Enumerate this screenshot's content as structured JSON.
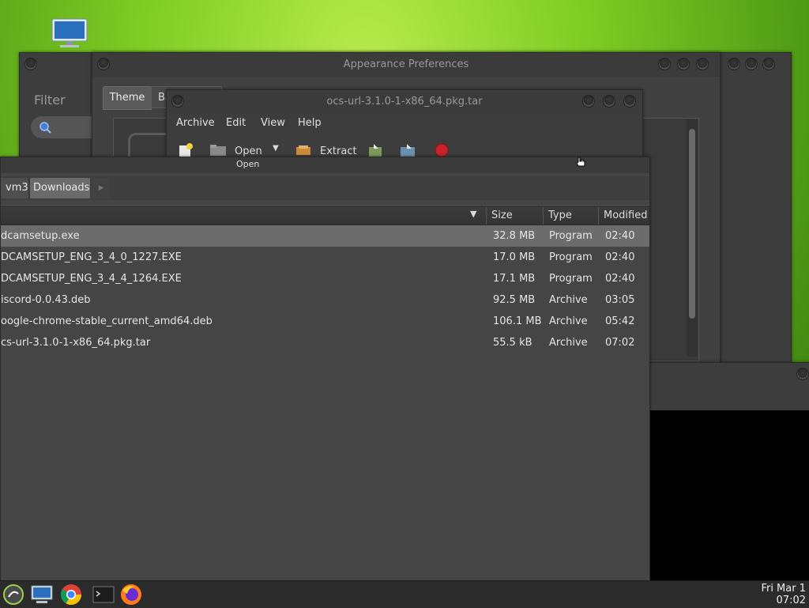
{
  "desktop": {
    "icon": "computer-icon"
  },
  "filter_window": {
    "filter_label": "Filter",
    "search_icon": "search-icon"
  },
  "appearance_window": {
    "title": "Appearance Preferences",
    "tabs": [
      "Theme",
      "Ba"
    ]
  },
  "archive_window": {
    "title": "ocs-url-3.1.0-1-x86_64.pkg.tar",
    "menu": [
      "Archive",
      "Edit",
      "View",
      "Help"
    ],
    "toolbar": {
      "open_label": "Open",
      "extract_label": "Extract"
    }
  },
  "file_chooser": {
    "title": "Open",
    "breadcrumbs": [
      "vm3",
      "Downloads"
    ],
    "columns": {
      "size": "Size",
      "type": "Type",
      "modified": "Modified"
    },
    "files": [
      {
        "name": "dcamsetup.exe",
        "size": "32.8 MB",
        "type": "Program",
        "modified": "02:40",
        "selected": true
      },
      {
        "name": "DCAMSETUP_ENG_3_4_0_1227.EXE",
        "size": "17.0 MB",
        "type": "Program",
        "modified": "02:40"
      },
      {
        "name": "DCAMSETUP_ENG_3_4_4_1264.EXE",
        "size": "17.1 MB",
        "type": "Program",
        "modified": "02:40"
      },
      {
        "name": "iscord-0.0.43.deb",
        "size": "92.5 MB",
        "type": "Archive",
        "modified": "03:05"
      },
      {
        "name": "oogle-chrome-stable_current_amd64.deb",
        "size": "106.1 MB",
        "type": "Archive",
        "modified": "05:42"
      },
      {
        "name": "cs-url-3.1.0-1-x86_64.pkg.tar",
        "size": "55.5 kB",
        "type": "Archive",
        "modified": "07:02"
      }
    ]
  },
  "taskbar": {
    "icons": [
      "menu-icon",
      "computer-icon",
      "chrome-icon",
      "terminal-icon",
      "firefox-icon"
    ],
    "clock": {
      "date": "Fri Mar 1",
      "time": "07:02"
    }
  }
}
